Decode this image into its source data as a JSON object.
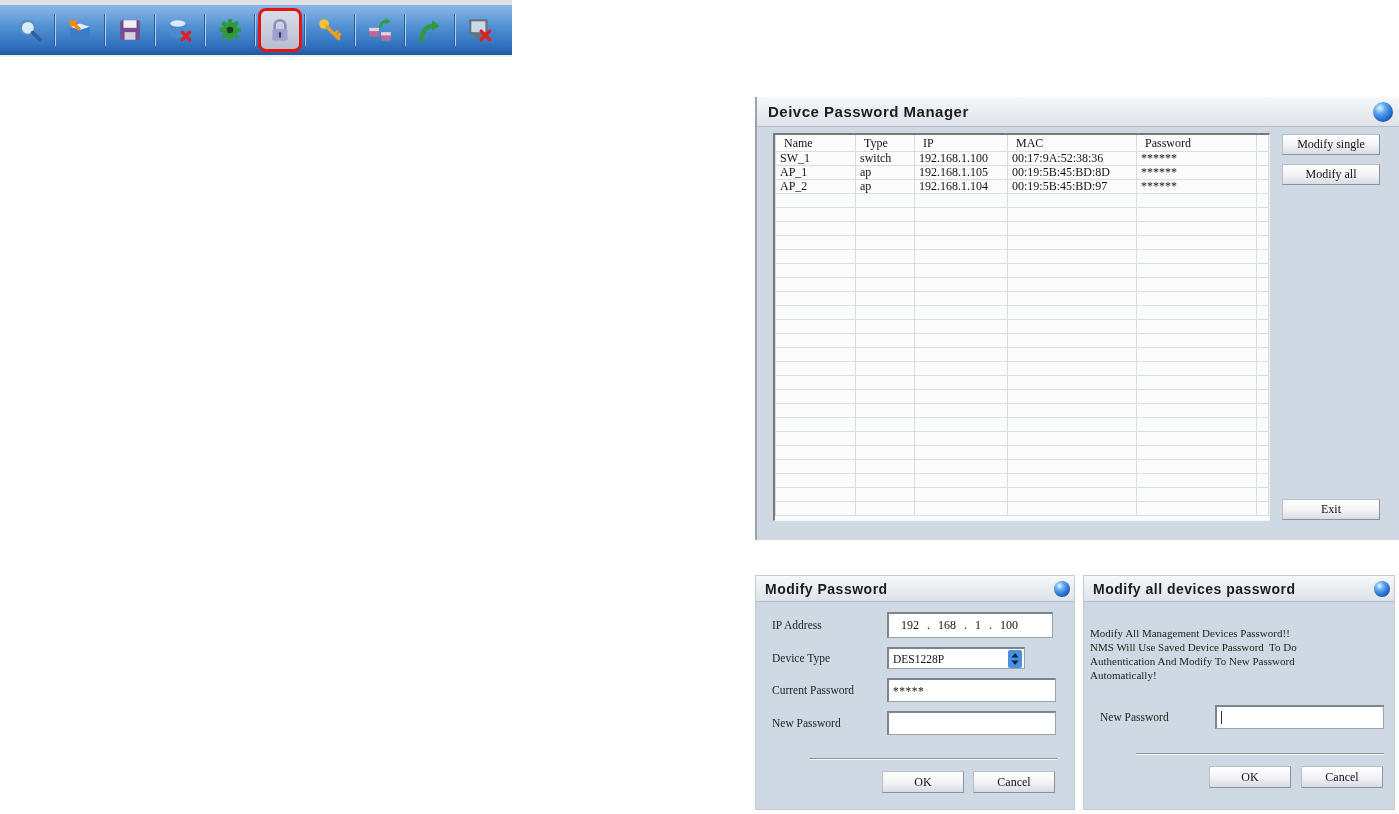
{
  "toolbar": {
    "buttons": [
      {
        "kind": "search",
        "selected": false
      },
      {
        "kind": "box",
        "selected": false
      },
      {
        "kind": "save",
        "selected": false
      },
      {
        "kind": "delete",
        "selected": false
      },
      {
        "kind": "settings",
        "selected": false
      },
      {
        "kind": "lock",
        "selected": true
      },
      {
        "kind": "key",
        "selected": false
      },
      {
        "kind": "network",
        "selected": false
      },
      {
        "kind": "undo",
        "selected": false
      },
      {
        "kind": "exit",
        "selected": false
      }
    ]
  },
  "password_manager": {
    "title": "Deivce Password Manager",
    "table": {
      "columns": [
        "Name",
        "Type",
        "IP",
        "MAC",
        "Password"
      ],
      "rows": [
        [
          "SW_1",
          "switch",
          "192.168.1.100",
          "00:17:9A:52:38:36",
          "******"
        ],
        [
          "AP_1",
          "ap",
          "192.168.1.105",
          "00:19:5B:45:BD:8D",
          "******"
        ],
        [
          "AP_2",
          "ap",
          "192.168.1.104",
          "00:19:5B:45:BD:97",
          "******"
        ]
      ]
    },
    "side_buttons": [
      "Modify single",
      "Modify all"
    ],
    "exit_button": "Exit"
  },
  "modify_password": {
    "title": "Modify Password",
    "fields": [
      {
        "label": "IP Address",
        "kind": "ip",
        "value": "192 . 168 . 1 . 100",
        "focused": false
      },
      {
        "label": "Device Type",
        "kind": "select",
        "value": "DES1228P",
        "focused": false
      },
      {
        "label": "Current Password",
        "kind": "password",
        "value": "*****",
        "focused": false
      },
      {
        "label": "New Password",
        "kind": "text",
        "focused": false
      }
    ],
    "buttons": [
      "OK",
      "Cancel"
    ]
  },
  "modify_all": {
    "title": "Modify all devices password",
    "message": "Modify All Management Devices Password!!\nNMS Will Use Saved Device Password  To Do\nAuthentication And Modify To New Password\nAutomatically!",
    "fields": [
      {
        "label": "New Password",
        "kind": "text",
        "focused": true
      }
    ],
    "buttons": [
      "OK",
      "Cancel"
    ]
  }
}
